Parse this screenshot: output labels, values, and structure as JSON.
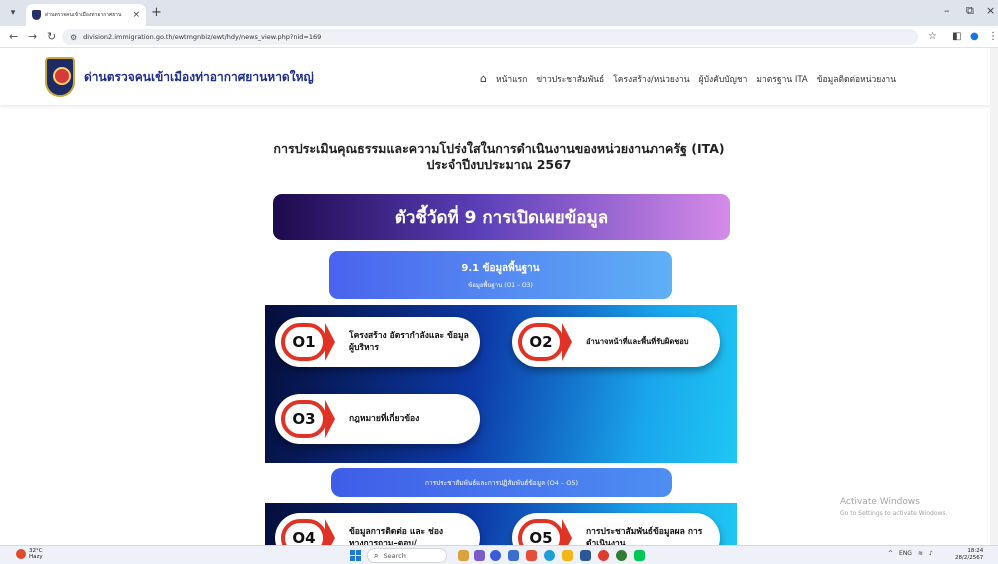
{
  "browser": {
    "tab_title": "ด่านตรวจคนเข้าเมืองท่าอากาศยาน",
    "tab_close": "×",
    "new_tab": "+",
    "url": "division2.immigration.go.th/ewtmgnbiz/ewt/hdy/news_view.php?nid=169",
    "icons": [
      "back-arrow-icon",
      "forward-arrow-icon",
      "reload-icon",
      "site-info-icon",
      "bookmark-star-icon",
      "sidepanel-icon",
      "profile-icon",
      "more-menu-icon"
    ]
  },
  "site": {
    "name": "ด่านตรวจคนเข้าเมืองท่าอากาศยานหาดใหญ่",
    "menu": [
      "หน้าแรก",
      "ข่าวประชาสัมพันธ์",
      "โครงสร้าง/หน่วยงาน",
      "ผู้บังคับบัญชา",
      "มาตรฐาน ITA",
      "ข้อมูลติดต่อหน่วยงาน"
    ]
  },
  "content": {
    "title_line1": "การประเมินคุณธรรมและความโปร่งใสในการดำเนินงานของหน่วยงานภาครัฐ (ITA)",
    "title_line2": "ประจำปีงบประมาณ 2567",
    "banner": "ตัวชี้วัดที่ 9 การเปิดเผยข้อมูล",
    "sub_title": "9.1 ข้อมูลพื้นฐาน",
    "sub_caption": "ข้อมูลพื้นฐาน (O1 – O3)",
    "items": [
      {
        "num": "O1",
        "label": "โครงสร้าง อัตรากำลังและ ข้อมูลผู้บริหาร"
      },
      {
        "num": "O2",
        "label": "อำนาจหน้าที่และพื้นที่รับผิดชอบ"
      },
      {
        "num": "O3",
        "label": "กฎหมายที่เกี่ยวข้อง"
      }
    ],
    "divider": "การประชาสัมพันธ์และการปฏิสัมพันธ์ข้อมูล (O4 – O5)",
    "items2": [
      {
        "num": "O4",
        "label": "ข้อมูลการติดต่อ และ ช่องทางการถาม–ตอบ/"
      },
      {
        "num": "O5",
        "label": "การประชาสัมพันธ์ข้อมูลผล การดำเนินงาน"
      }
    ]
  },
  "watermark": {
    "line1": "Activate Windows",
    "line2": "Go to Settings to activate Windows."
  },
  "taskbar": {
    "temp": "32°C",
    "weather_desc": "Hazy",
    "search": "Search",
    "lang": "ENG",
    "time": "18:24",
    "date": "28/2/2567"
  }
}
